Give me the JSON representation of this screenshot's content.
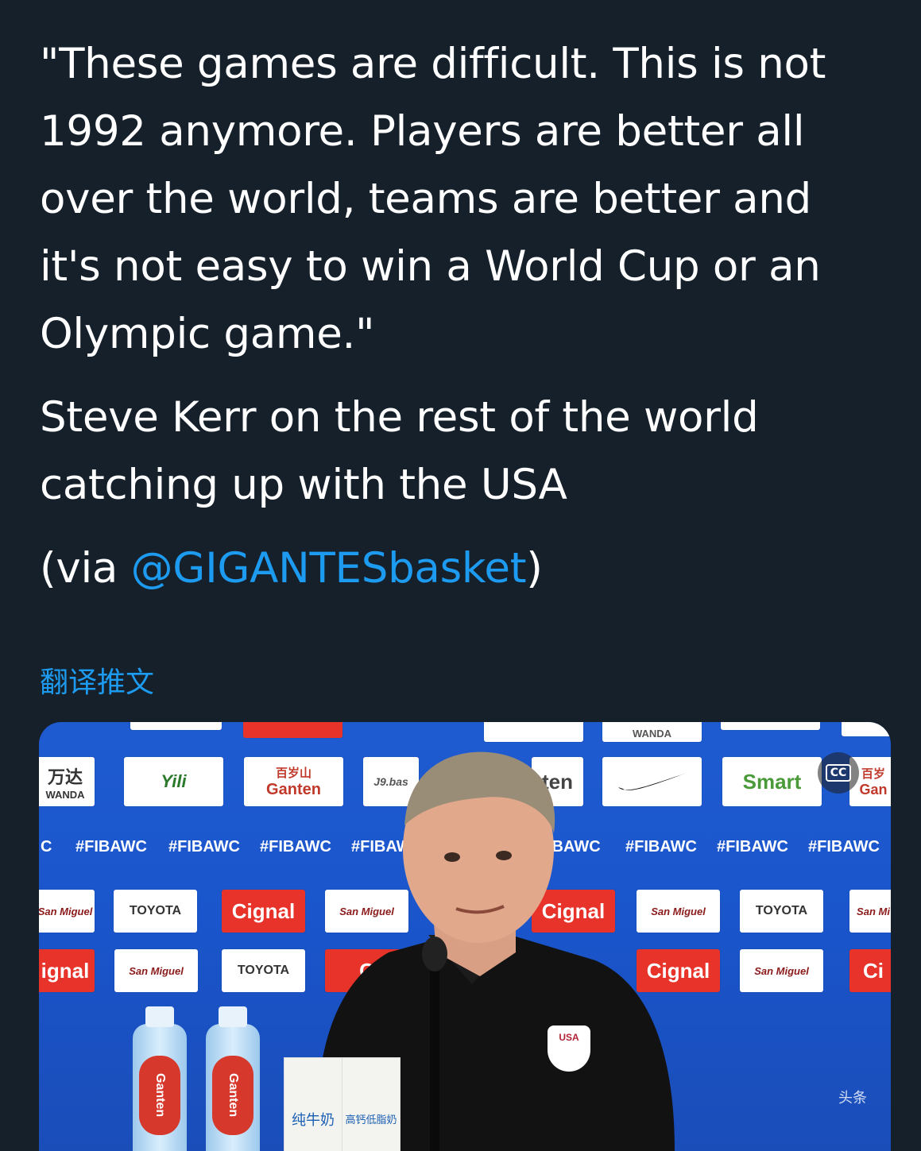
{
  "tweet": {
    "quote_lines": [
      "\"These games are difficult. This is not",
      "1992 anymore. Players are better all",
      "over the world, teams are better and",
      "it's not easy to win a World Cup or an",
      "Olympic game.\""
    ],
    "attribution_lines": [
      "Steve Kerr on the rest of the world",
      "catching up with the USA"
    ],
    "via_prefix": "(via ",
    "via_mention": "@GIGANTESbasket",
    "via_suffix": ")",
    "translate_label": "翻译推文"
  },
  "media": {
    "top_row": [
      "万达",
      "WANDA",
      "Yili",
      "百岁山",
      "Ganten",
      "J9.bas",
      "ten",
      "Smart",
      "百岁",
      "Gan"
    ],
    "top_strip": [
      "WANDA"
    ],
    "hashtags": [
      "C",
      "#FIBAWC",
      "#FIBAWC",
      "#FIBAWC",
      "#FIBAW",
      "IBAWC",
      "#FIBAWC",
      "#FIBAWC",
      "#FIBAWC"
    ],
    "row3": [
      "San Miguel",
      "TOYOTA",
      "Cignal",
      "San Miguel",
      "Cignal",
      "San Miguel",
      "TOYOTA",
      "San Mi"
    ],
    "row4": [
      "ignal",
      "San Miguel",
      "TOYOTA",
      "C",
      "Cignal",
      "San Miguel",
      "Ci"
    ],
    "bottle_label": "Ganten",
    "milk_labels": [
      "纯牛奶",
      "高钙低脂奶"
    ],
    "cc_label": "CC",
    "badge_text": "USA",
    "watermark": "头条"
  },
  "colors": {
    "background": "#15202b",
    "link": "#1d9bf0",
    "court_blue": "#1f5bd0"
  }
}
